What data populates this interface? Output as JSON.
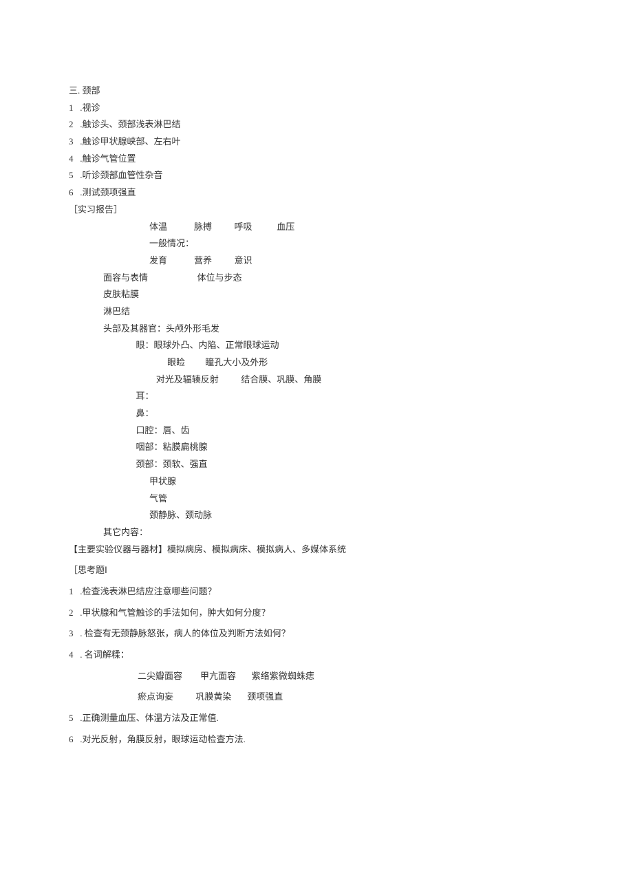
{
  "section3": {
    "title": "三. 颈部",
    "items": [
      {
        "num": "1",
        "text": ".视诊"
      },
      {
        "num": "2",
        "text": ".触诊头、颈部浅表淋巴结"
      },
      {
        "num": "3",
        "text": ".触诊甲状腺峡部、左右叶"
      },
      {
        "num": "4",
        "text": ".触诊气管位置"
      },
      {
        "num": "5",
        "text": ".听诊颈部血管性杂音"
      },
      {
        "num": "6",
        "text": ".测试颈项强直"
      }
    ]
  },
  "report": {
    "heading": "［实习报告］",
    "vitals": {
      "l1": "体温",
      "l2": "脉搏",
      "l3": "呼吸",
      "l4": "血压"
    },
    "general_label": "一般情况：",
    "general": {
      "l1": "发育",
      "l2": "营养",
      "l3": "意识"
    },
    "row_face": {
      "a": "面容与表情",
      "b": "体位与步态"
    },
    "skin": "皮肤粘膜",
    "ln": "淋巴结",
    "head": {
      "title": "头部及其器官：头颅外形毛发",
      "eye1": "眼：眼球外凸、内陷、正常眼球运动",
      "eye2a": "眼睑",
      "eye2b": "瞳孔大小及外形",
      "eye3a": "对光及辐辏反射",
      "eye3b": "结合膜、巩膜、角膜",
      "ear": "耳：",
      "nose": "鼻：",
      "mouth": "口腔：唇、齿",
      "pharynx": "咽部：粘膜扁桃腺",
      "neck": "颈部：颈软、强直",
      "thyroid": "甲状腺",
      "trachea": "气管",
      "jugular": "颈静脉、颈动脉"
    },
    "other": "其它内容："
  },
  "equipment": "【主要实验仪器与器材】模拟病房、模拟病床、模拟病人、多媒体系统",
  "questions": {
    "heading": "［思考题Ⅰ",
    "items": [
      {
        "num": "1",
        "text": ".检查浅表淋巴结应注意哪些问题？"
      },
      {
        "num": "2",
        "text": ".甲状腺和气管触诊的手法如何，肿大如何分度？"
      },
      {
        "num": "3",
        "text": ". 检查有无颈静脉怒张，病人的体位及判断方法如何？"
      },
      {
        "num": "4",
        "text": ". 名词解糅："
      }
    ],
    "terms": {
      "row1a": "二尖瓣面容",
      "row1b": "甲亢面容",
      "row1c": "紫络紫微蜘蛛痣",
      "row2a": "瘀点询妄",
      "row2b": "巩膜黄染",
      "row2c": "颈项强直"
    },
    "items2": [
      {
        "num": "5",
        "text": ".正确测量血压、体温方法及正常值."
      },
      {
        "num": "6",
        "text": ".对光反射，角膜反射，眼球运动检查方法."
      }
    ]
  }
}
